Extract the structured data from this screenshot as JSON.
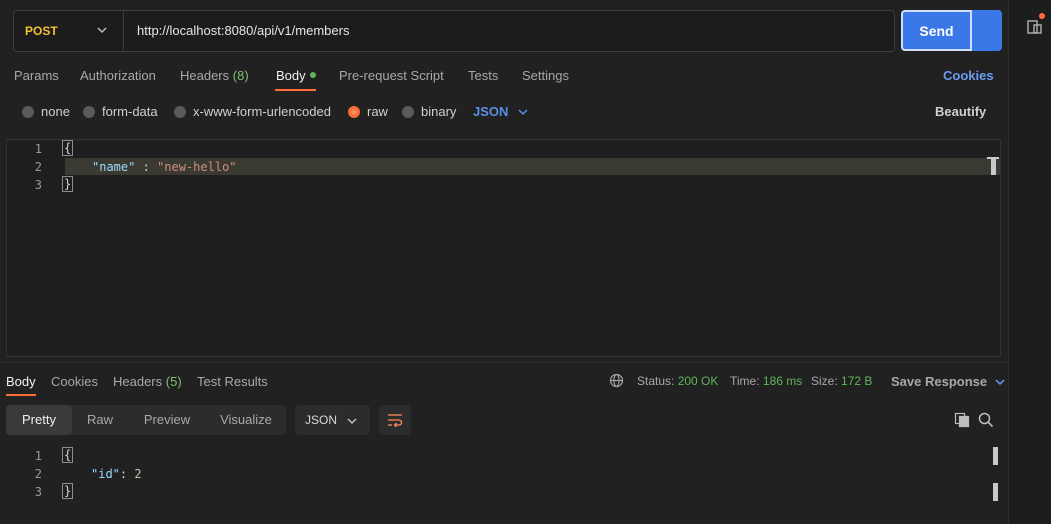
{
  "request": {
    "method": "POST",
    "url": "http://localhost:8080/api/v1/members",
    "send_label": "Send"
  },
  "request_tabs": [
    {
      "label": "Params"
    },
    {
      "label": "Authorization"
    },
    {
      "label": "Headers",
      "count": "(8)"
    },
    {
      "label": "Body"
    },
    {
      "label": "Pre-request Script"
    },
    {
      "label": "Tests"
    },
    {
      "label": "Settings"
    }
  ],
  "cookies_label": "Cookies",
  "body_types": [
    {
      "label": "none",
      "selected": false
    },
    {
      "label": "form-data",
      "selected": false
    },
    {
      "label": "x-www-form-urlencoded",
      "selected": false
    },
    {
      "label": "raw",
      "selected": true
    },
    {
      "label": "binary",
      "selected": false
    }
  ],
  "body_format": "JSON",
  "beautify_label": "Beautify",
  "request_body": {
    "line_numbers": [
      "1",
      "2",
      "3"
    ],
    "open": "{",
    "key": "\"name\"",
    "sep": " : ",
    "value": "\"new-hello\"",
    "close": "}"
  },
  "response_tabs": [
    {
      "label": "Body"
    },
    {
      "label": "Cookies"
    },
    {
      "label": "Headers",
      "count": "(5)"
    },
    {
      "label": "Test Results"
    }
  ],
  "response_meta": {
    "status_label": "Status:",
    "status_value": "200 OK",
    "time_label": "Time:",
    "time_value": "186 ms",
    "size_label": "Size:",
    "size_value": "172 B",
    "save_label": "Save Response"
  },
  "view_modes": [
    "Pretty",
    "Raw",
    "Preview",
    "Visualize"
  ],
  "response_format": "JSON",
  "response_body": {
    "line_numbers": [
      "1",
      "2",
      "3"
    ],
    "open": "{",
    "key": "\"id\"",
    "sep": ": ",
    "value": "2",
    "close": "}"
  },
  "colors": {
    "accent": "#ff6c37",
    "send": "#3b78e7",
    "method": "#f2c037",
    "status_ok": "#5fb65a"
  }
}
